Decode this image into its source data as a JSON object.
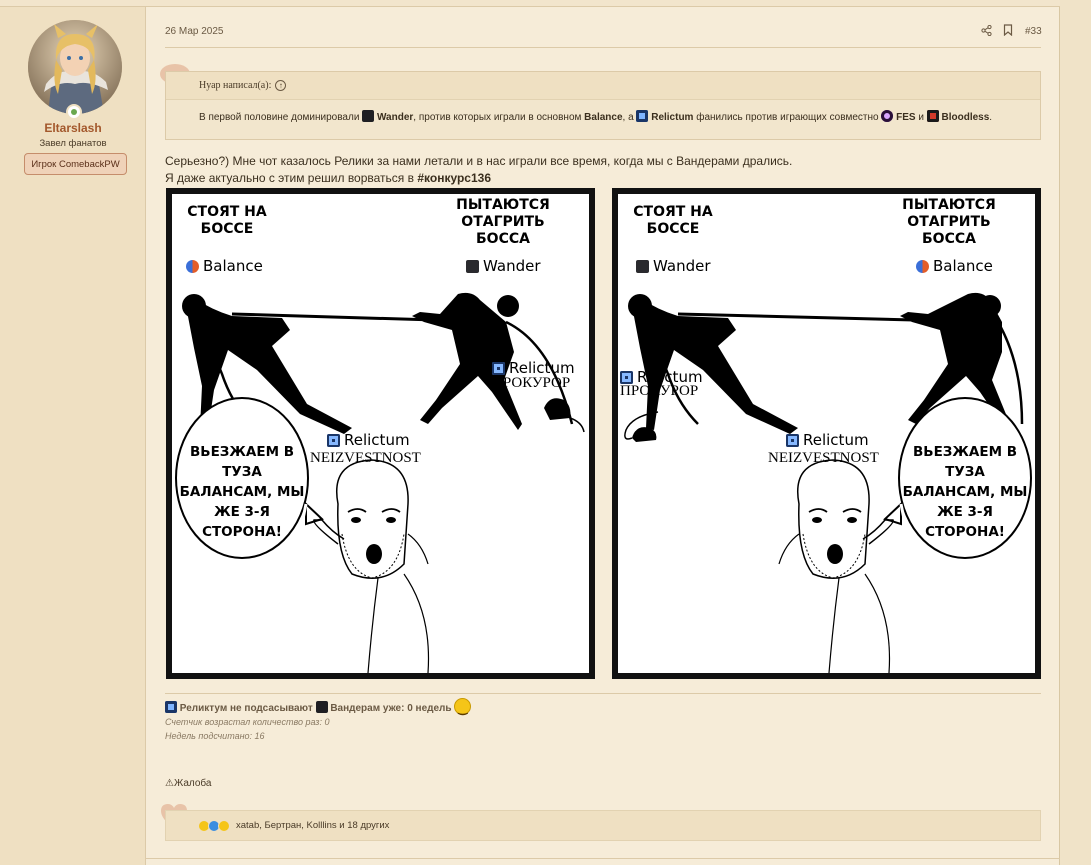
{
  "post": {
    "date": "26 Мар 2025",
    "number": "#33",
    "share_icon": "share-icon",
    "bookmark_icon": "bookmark-icon"
  },
  "user": {
    "name": "Eltarslash",
    "title": "Завел фанатов",
    "badge": "Игрок ComebackPW",
    "status_color": "#6aa84f"
  },
  "quote": {
    "author": "Нуар написал(а):",
    "prefix": "В первой половине доминировали",
    "team1": "Wander",
    "mid1": ", против которых играли в основном",
    "team2": "Balance",
    "mid2": ", а",
    "team3": "Relictum",
    "mid3": "фанились против играющих совместно",
    "team4": "FES",
    "and": "и",
    "team5": "Bloodless",
    "end": "."
  },
  "message": {
    "line1": "Серьезно?) Мне чот казалось Релики за нами летали и в нас играли все время, когда мы с Вандерами дрались.",
    "line2_prefix": "Я даже актуально с этим решил ворваться в",
    "hashtag": "#конкурс136"
  },
  "meme_left": {
    "top_left": "СТОЯТ НА БОССЕ",
    "top_right": "ПЫТАЮТСЯ ОТАГРИТЬ БОССА",
    "team_left": "Balance",
    "team_right": "Wander",
    "rat_team": "Relictum",
    "rat_label": "ПРОКУРОР",
    "guy_team": "Relictum",
    "guy_label": "NEIZVESTNOST",
    "bubble": "ВЬЕЗЖАЕМ В ТУЗА БАЛАНСАМ, МЫ ЖЕ 3-Я СТОРОНА!"
  },
  "meme_right": {
    "top_left": "СТОЯТ НА БОССЕ",
    "top_right": "ПЫТАЮТСЯ ОТАГРИТЬ БОССА",
    "team_left": "Wander",
    "team_right": "Balance",
    "rat_team": "Relictum",
    "rat_label": "ПРОКУРОР",
    "guy_team": "Relictum",
    "guy_label": "NEIZVESTNOST",
    "bubble": "ВЬЕЗЖАЕМ В ТУЗА БАЛАНСАМ, МЫ ЖЕ 3-Я СТОРОНА!"
  },
  "signature": {
    "part1": "Реликтум не подсасывают",
    "part2": "Вандерам уже: 0 недель",
    "counter": "Счетчик возрастал количество раз: 0",
    "weeks": "Недель подсчитано: 16"
  },
  "actions": {
    "report": "Жалоба"
  },
  "reactions": {
    "names": "xatab, Бертран, Kolllins и 18 других"
  }
}
